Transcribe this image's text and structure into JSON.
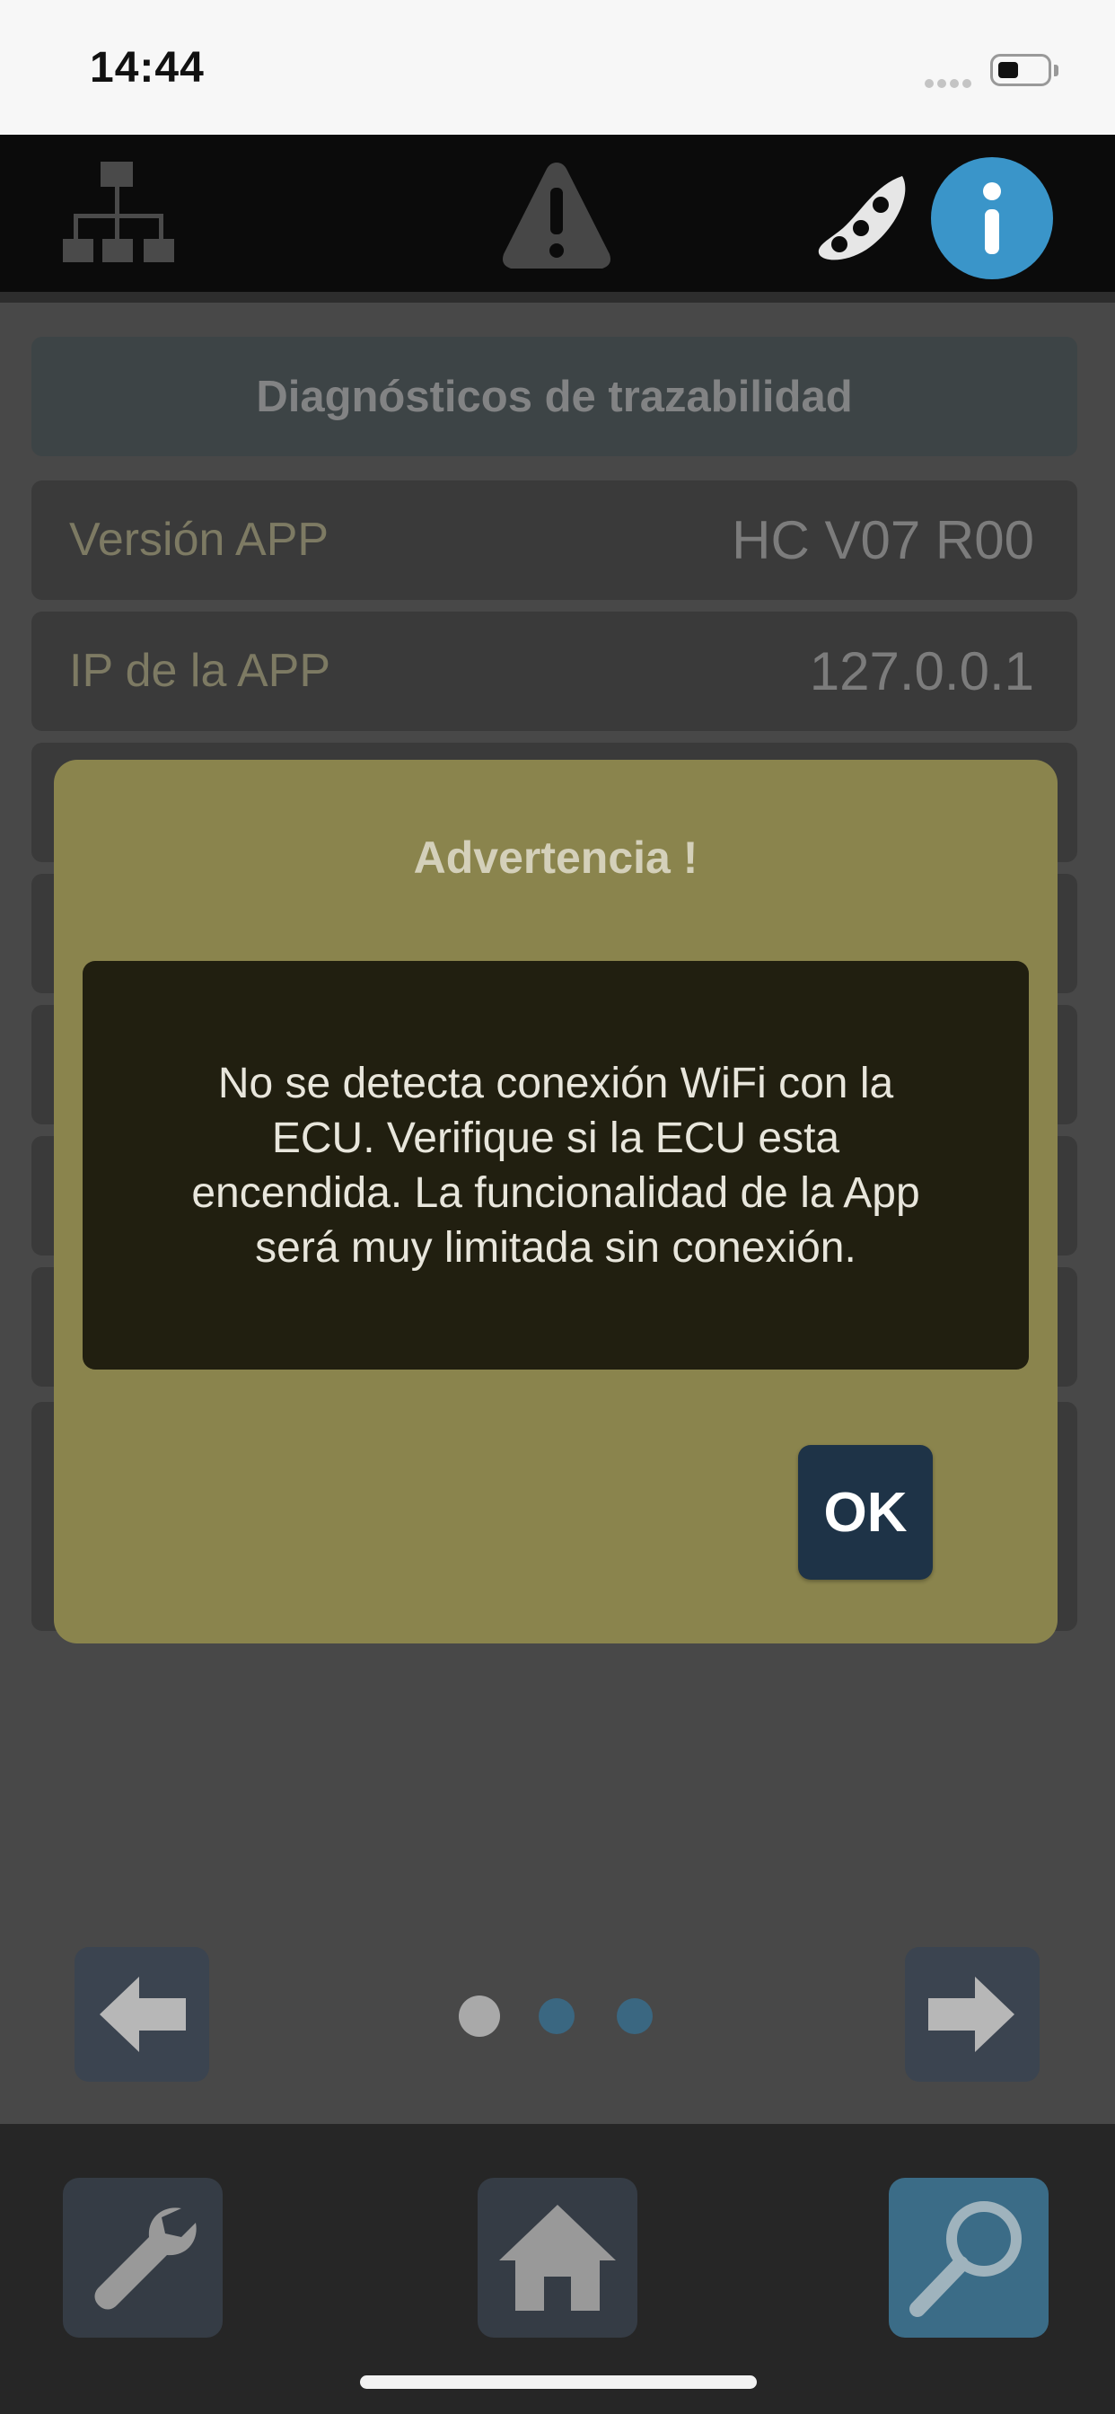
{
  "status_bar": {
    "time": "14:44"
  },
  "top_bar": {
    "icons": [
      "network-icon",
      "alert-icon",
      "soybean-icon",
      "info-icon"
    ]
  },
  "content": {
    "section_title": "Diagnósticos de trazabilidad",
    "rows": [
      {
        "label": "Versión APP",
        "value": "HC V07 R00"
      },
      {
        "label": "IP de la APP",
        "value": "127.0.0.1"
      }
    ]
  },
  "pager": {
    "current_page": 1,
    "total_pages": 3
  },
  "bottom_nav": {
    "icons": [
      "wrench-icon",
      "home-icon",
      "magnifier-icon"
    ]
  },
  "modal": {
    "title": "Advertencia !",
    "message": "No se detecta conexión WiFi con la ECU. Verifique si la ECU esta encendida. La funcionalidad de la App será muy limitada sin conexión.",
    "ok_label": "OK"
  },
  "colors": {
    "info_accent": "#3a95c9",
    "modal_background": "#8a844d",
    "ok_button": "#1e3347"
  }
}
